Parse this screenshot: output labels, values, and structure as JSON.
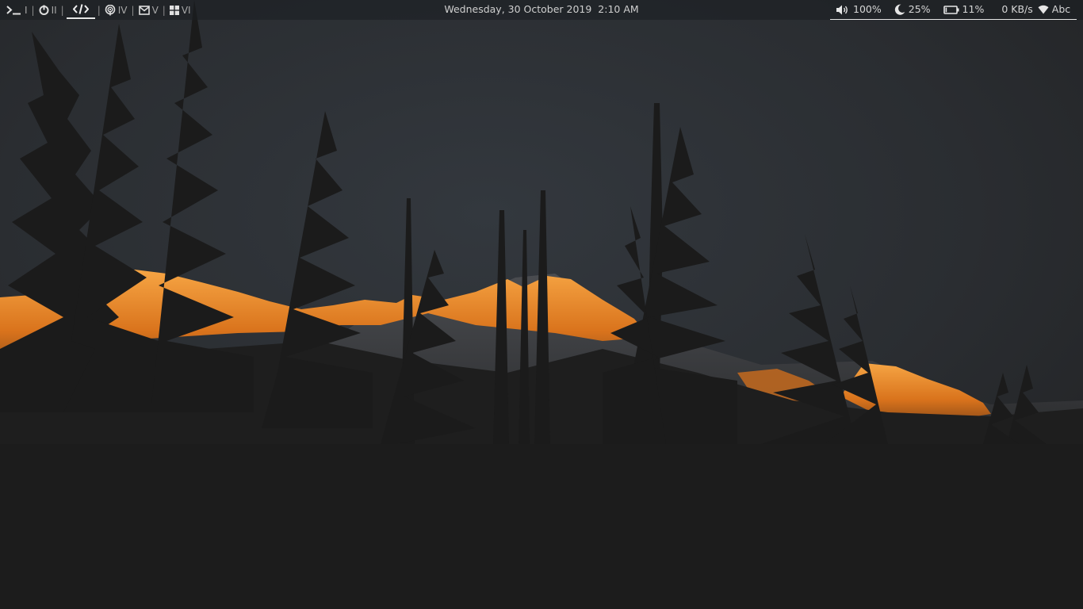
{
  "panel": {
    "workspaces": [
      {
        "id": "I",
        "label": "I",
        "icon": "terminal-icon"
      },
      {
        "id": "II",
        "label": "II",
        "icon": "power-refresh-icon"
      },
      {
        "id": "III",
        "label": "",
        "icon": "code-icon",
        "active": true
      },
      {
        "id": "IV",
        "label": "IV",
        "icon": "podcast-icon"
      },
      {
        "id": "V",
        "label": "V",
        "icon": "mail-icon"
      },
      {
        "id": "VI",
        "label": "VI",
        "icon": "windows-grid-icon"
      }
    ],
    "separator": "|",
    "datetime": "Wednesday, 30 October 2019  2:10 AM",
    "status": {
      "volume": "100%",
      "night_light": "25%",
      "battery": "11%",
      "network_speed": "0 KB/s",
      "keyboard_layout": "Abc"
    }
  },
  "colors": {
    "panel_text": "#c9c9c9",
    "active_underline": "#e6e6e6",
    "sky": "#2c3036",
    "glow": "#e8892a",
    "ground": "#1c1c1c"
  }
}
